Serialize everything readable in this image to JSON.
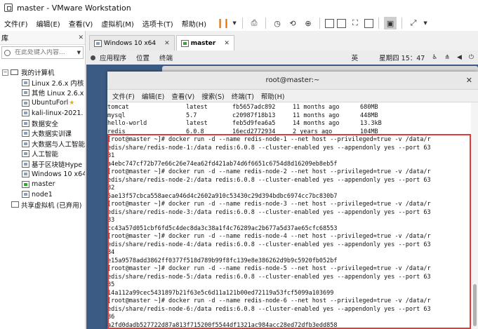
{
  "window": {
    "title": "master - VMware Workstation"
  },
  "vm_menu": [
    "文件(F)",
    "编辑(E)",
    "查看(V)",
    "虚拟机(M)",
    "选项卡(T)",
    "帮助(H)"
  ],
  "sidebar": {
    "header": "库",
    "search_placeholder": "在此处键入内容...",
    "root": "我的计算机",
    "items": [
      {
        "label": "Linux 2.6.x 内核"
      },
      {
        "label": "其他 Linux 2.6.x"
      },
      {
        "label": "UbuntuForl"
      },
      {
        "label": "kali-linux-2021."
      },
      {
        "label": "数据安全"
      },
      {
        "label": "大数据实训课"
      },
      {
        "label": "大数据与人工智能"
      },
      {
        "label": "人工智能"
      },
      {
        "label": "基于区块链Hype"
      },
      {
        "label": "Windows 10 x64"
      },
      {
        "label": "master"
      },
      {
        "label": "node1"
      }
    ],
    "shared": "共享虚拟机 (已弃用)"
  },
  "tabs": [
    {
      "label": "Windows 10 x64"
    },
    {
      "label": "master"
    }
  ],
  "gnome": {
    "apps": "应用程序",
    "places": "位置",
    "terminal": "终端",
    "ime": "英",
    "clock": "星期四 15：47"
  },
  "terminal": {
    "title": "root@master:~",
    "menu": [
      "文件(F)",
      "编辑(E)",
      "查看(V)",
      "搜索(S)",
      "终端(T)",
      "帮助(H)"
    ],
    "images": [
      {
        "repo": "tomcat",
        "tag": "latest",
        "id": "fb5657adc892",
        "created": "11 months ago",
        "size": "680MB"
      },
      {
        "repo": "mysql",
        "tag": "5.7",
        "id": "c20987f18b13",
        "created": "11 months ago",
        "size": "448MB"
      },
      {
        "repo": "hello-world",
        "tag": "latest",
        "id": "feb5d9fea6a5",
        "created": "14 months ago",
        "size": "13.3kB"
      },
      {
        "repo": "redis",
        "tag": "6.0.8",
        "id": "16ecd2772934",
        "created": "2 years ago",
        "size": "104MB"
      }
    ],
    "lines": [
      "[root@master ~]# docker run -d --name redis-node-1 --net host --privileged=true -v /data/r",
      "edis/share/redis-node-1:/data redis:6.0.8 --cluster-enabled yes --appendonly yes --port 63",
      "81",
      "a4ebc747cf72b77e66c26e74ea62fd421ab74d6f6651c6754d8d16209eb8eb5f",
      "[root@master ~]# docker run -d --name redis-node-2 --net host --privileged=true -v /data/r",
      "edis/share/redis-node-2:/data redis:6.0.8 --cluster-enabled yes --appendonly yes --port 63",
      "82",
      "5ae13f57cbca558aeca946d4c2602a910c53430c29d394bdbc6974cc7bc830b7",
      "[root@master ~]# docker run -d --name redis-node-3 --net host --privileged=true -v /data/r",
      "edis/share/redis-node-3:/data redis:6.0.8 --cluster-enabled yes --appendonly yes --port 63",
      "83",
      "cc43a57d051cbf6fd5c4dec8da3c38a1f4c76289ac2b677a5d37ae65cfc68553",
      "[root@master ~]# docker run -d --name redis-node-4 --net host --privileged=true -v /data/r",
      "edis/share/redis-node-4:/data redis:6.0.8 --cluster-enabled yes --appendonly yes --port 63",
      "84",
      "e15a9578add3862ff0377f518d789b99f8fc139e8e386262d9b9c5920fb052bf",
      "[root@master ~]# docker run -d --name redis-node-5 --net host --privileged=true -v /data/r",
      "edis/share/redis-node-5:/data redis:6.0.8 --cluster-enabled yes --appendonly yes --port 63",
      "85",
      "14a112a99cec5431897b21f63e5c6d11a121b00ed72119a53fcf5099a103699",
      "[root@master ~]# docker run -d --name redis-node-6 --net host --privileged=true -v /data/r",
      "edis/share/redis-node-6:/data redis:6.0.8 --cluster-enabled yes --appendonly yes --port 63",
      "86",
      "a2fd0dadb527722d87a813f715200f5544df1321ac984acc28ed72dfb3edd858"
    ]
  },
  "colors": {
    "highlight": "#e23a3a",
    "pause": "#e66b00"
  }
}
